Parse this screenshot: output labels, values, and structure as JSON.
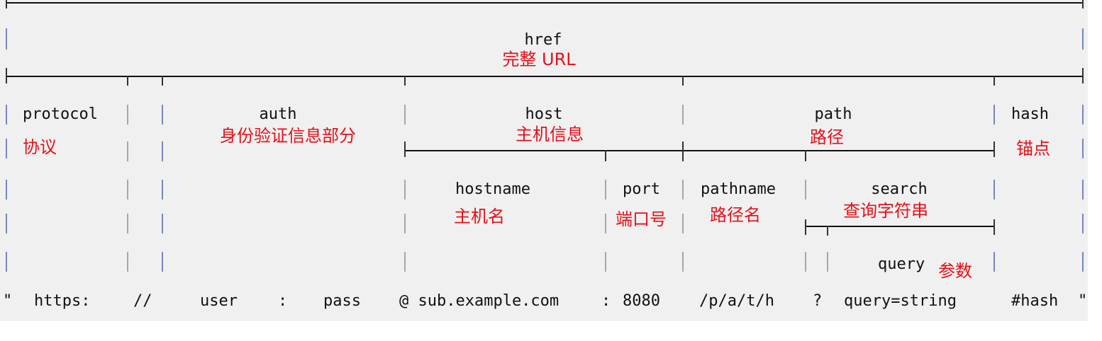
{
  "diagram": {
    "href": {
      "label": "href",
      "note": "完整 URL"
    },
    "protocol": {
      "label": "protocol",
      "note": "协议"
    },
    "auth": {
      "label": "auth",
      "note": "身份验证信息部分"
    },
    "host": {
      "label": "host",
      "note": "主机信息"
    },
    "path": {
      "label": "path",
      "note": "路径"
    },
    "hash": {
      "label": "hash",
      "note": "锚点"
    },
    "hostname": {
      "label": "hostname",
      "note": "主机名"
    },
    "port": {
      "label": "port",
      "note": "端口号"
    },
    "pathname": {
      "label": "pathname",
      "note": "路径名"
    },
    "search": {
      "label": "search",
      "note": "查询字符串"
    },
    "query": {
      "label": "query",
      "note": "参数"
    }
  },
  "url_parts": {
    "open_quote": "\"",
    "protocol": "https:",
    "slashes": "//",
    "user": "user",
    "colon1": ":",
    "pass": "pass",
    "at_host": "@ sub.example.com",
    "colon2": ":",
    "port": "8080",
    "path": "/p/a/t/h",
    "question": "?",
    "query": "query=string",
    "hash": "#hash",
    "close_quote": "\""
  },
  "colors": {
    "annotation": "#e3111a",
    "text": "#111111",
    "background": "#f0f0f0"
  }
}
